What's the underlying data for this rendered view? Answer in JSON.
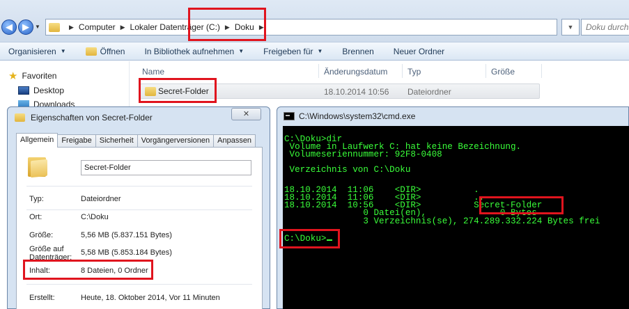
{
  "explorer": {
    "breadcrumb": [
      "Computer",
      "Lokaler Datenträger (C:)",
      "Doku"
    ],
    "search_placeholder": "Doku durchsuchen",
    "toolbar": {
      "organize": "Organisieren",
      "open": "Öffnen",
      "library": "In Bibliothek aufnehmen",
      "share": "Freigeben für",
      "burn": "Brennen",
      "new_folder": "Neuer Ordner"
    },
    "nav": {
      "favorites": "Favoriten",
      "desktop": "Desktop",
      "downloads": "Downloads"
    },
    "columns": {
      "name": "Name",
      "date": "Änderungsdatum",
      "type": "Typ",
      "size": "Größe"
    },
    "rows": [
      {
        "name": "Secret-Folder",
        "date": "18.10.2014 10:56",
        "type": "Dateiordner",
        "size": ""
      }
    ]
  },
  "properties": {
    "title": "Eigenschaften von Secret-Folder",
    "close": "✕",
    "tabs": [
      "Allgemein",
      "Freigabe",
      "Sicherheit",
      "Vorgängerversionen",
      "Anpassen"
    ],
    "folder_name": "Secret-Folder",
    "fields": {
      "type_label": "Typ:",
      "type_value": "Dateiordner",
      "location_label": "Ort:",
      "location_value": "C:\\Doku",
      "size_label": "Größe:",
      "size_value": "5,56 MB (5.837.151 Bytes)",
      "disk_label_1": "Größe auf",
      "disk_label_2": "Datenträger:",
      "disk_value": "5,58 MB (5.853.184 Bytes)",
      "contents_label": "Inhalt:",
      "contents_value": "8 Dateien, 0 Ordner",
      "created_label": "Erstellt:",
      "created_value": "Heute, 18. Oktober 2014, Vor 11 Minuten"
    }
  },
  "cmd": {
    "title": "C:\\Windows\\system32\\cmd.exe",
    "lines": [
      "C:\\Doku>dir",
      " Volume in Laufwerk C: hat keine Bezeichnung.",
      " Volumeseriennummer: 92F8-0408",
      "",
      " Verzeichnis von C:\\Doku",
      "",
      "18.10.2014  11:06    <DIR>          .",
      "18.10.2014  11:06    <DIR>          ..",
      "18.10.2014  10:56    <DIR>          Secret-Folder",
      "               0 Datei(en),              0 Bytes",
      "               3 Verzeichnis(se), 274.289.332.224 Bytes frei",
      "",
      "C:\\Doku>"
    ]
  }
}
